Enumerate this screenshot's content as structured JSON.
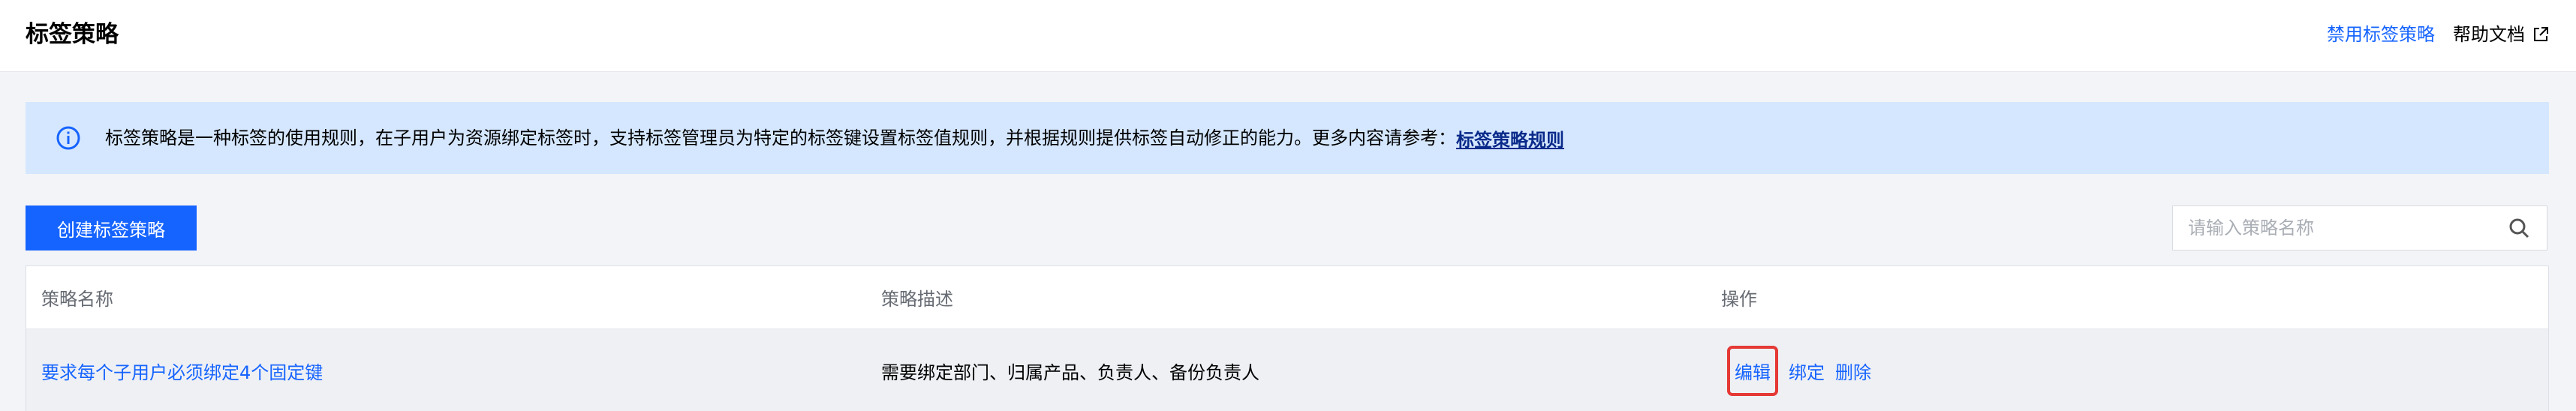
{
  "header": {
    "title": "标签策略",
    "disable_link": "禁用标签策略",
    "help_link": "帮助文档"
  },
  "notice": {
    "text": "标签策略是一种标签的使用规则，在子用户为资源绑定标签时，支持标签管理员为特定的标签键设置标签值规则，并根据规则提供标签自动修正的能力。更多内容请参考：",
    "link": "标签策略规则"
  },
  "toolbar": {
    "create_label": "创建标签策略",
    "search_placeholder": "请输入策略名称"
  },
  "table": {
    "columns": [
      "策略名称",
      "策略描述",
      "操作"
    ],
    "rows": [
      {
        "name": "要求每个子用户必须绑定4个固定键",
        "description": "需要绑定部门、归属产品、负责人、备份负责人",
        "actions": [
          "编辑",
          "绑定",
          "删除"
        ]
      }
    ]
  },
  "colors": {
    "accent": "#1664ff",
    "notice_bg": "#d5e7ff",
    "highlight": "#e53935"
  }
}
